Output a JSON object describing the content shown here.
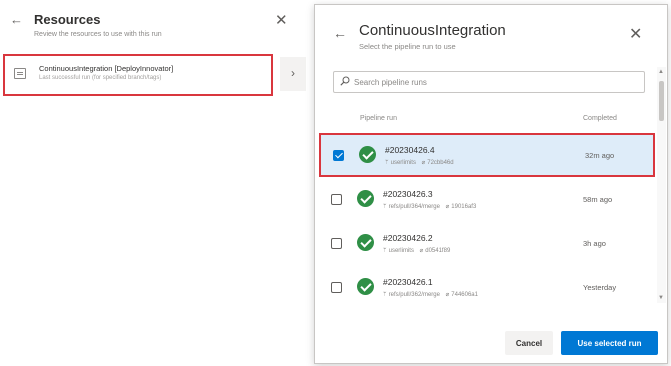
{
  "resources_panel": {
    "back_glyph": "←",
    "title": "Resources",
    "subtitle": "Review the resources to use with this run",
    "close_glyph": "✕",
    "resource": {
      "title": "ContinuousIntegration [DeployInnovator]",
      "subtitle": "Last successful run (for specified branch/tags)",
      "icon": "pipeline-icon",
      "chevron_glyph": "›"
    }
  },
  "dialog": {
    "back_glyph": "←",
    "title": "ContinuousIntegration",
    "subtitle": "Select the pipeline run to use",
    "close_glyph": "✕",
    "search": {
      "placeholder": "Search pipeline runs",
      "value": ""
    },
    "columns": {
      "run": "Pipeline run",
      "completed": "Completed"
    },
    "runs": [
      {
        "id": "#20230426.4",
        "branch": "userlimits",
        "commit": "72cbb46d",
        "completed": "32m ago",
        "checked": true,
        "status": "succeeded"
      },
      {
        "id": "#20230426.3",
        "branch": "refs/pull/364/merge",
        "commit": "19016af3",
        "completed": "58m ago",
        "checked": false,
        "status": "succeeded"
      },
      {
        "id": "#20230426.2",
        "branch": "userlimits",
        "commit": "d0541f89",
        "completed": "3h ago",
        "checked": false,
        "status": "succeeded"
      },
      {
        "id": "#20230426.1",
        "branch": "refs/pull/362/merge",
        "commit": "744606a1",
        "completed": "Yesterday",
        "checked": false,
        "status": "succeeded"
      }
    ],
    "branch_glyph": "ᛘ",
    "commit_glyph": "⌀",
    "cancel_label": "Cancel",
    "use_label": "Use selected run"
  },
  "colors": {
    "accent": "#0078d4",
    "success": "#2f8f46",
    "highlight_border": "#d9363e",
    "selected_row": "#deecf9"
  }
}
